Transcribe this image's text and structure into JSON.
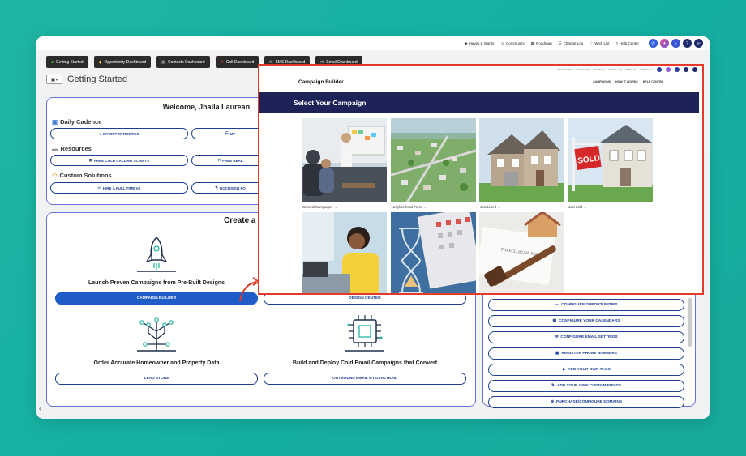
{
  "topbar": {
    "links": [
      "Haves & Wants",
      "Community",
      "Roadmap",
      "Change Log",
      "Wish List",
      "Help Center"
    ],
    "icons": [
      {
        "name": "phone-icon",
        "color": "#2f5fe0",
        "glyph": "✆"
      },
      {
        "name": "gradient-icon",
        "color": "#9b51e0",
        "glyph": "✦"
      },
      {
        "name": "bell-icon",
        "color": "#3955d4",
        "glyph": "♪"
      },
      {
        "name": "help-icon",
        "color": "#1e2a6b",
        "glyph": "?"
      },
      {
        "name": "avatar",
        "color": "#1e2a6b",
        "glyph": "JP"
      }
    ]
  },
  "tabs": [
    "Getting Started",
    "Opportunity Dashboard",
    "Contacts Dashboard",
    "Call Dashboard",
    "SMS Dashboard",
    "Email Dashboard"
  ],
  "page_title": "Getting Started",
  "welcome": {
    "heading": "Welcome, Jhaila Laurean",
    "daily_cadence": "Daily Cadence",
    "resources": "Resources",
    "custom_solutions": "Custom Solutions",
    "btn_opportunities": "MY OPPORTUNITIES",
    "btn_my": "MY",
    "btn_cold_scripts": "FREE COLD CALLING SCRIPTS",
    "btn_free_real": "FREE REAL",
    "btn_hire_va": "HIRE A FULL TIME VA",
    "btn_docusign": "DOCUSIGN FO"
  },
  "create": {
    "heading": "Create a",
    "feature1_title": "Launch Proven Campaigns from Pre-Built Designs",
    "feature1_btn": "CAMPAIGN BUILDER",
    "feature2_btn": "DESIGN CENTER",
    "feature3_title": "Order Accurate Homeowner and Property Data",
    "feature3_btn": "LEAD STORE",
    "feature4_title": "Build and Deploy Cold Email Campaigns that Convert",
    "feature4_btn": "OUTBOUND EMAIL BY DEALTRAIL"
  },
  "settings": {
    "buttons": [
      "CONFIGURE OPPORTUNITIES",
      "CONFIGURE YOUR CALENDARS",
      "CONFIGURE EMAIL SETTINGS",
      "REGISTER PHONE NUMBERS",
      "ADD YOUR OWN TAGS",
      "ADD YOUR OWN CUSTOM FIELDS",
      "PURCHASE/CONFIGURE DOMAINS"
    ]
  },
  "overlay": {
    "topbar_links": [
      "Haves & Wants",
      "Community",
      "Roadmap",
      "Change Log",
      "Wish List",
      "Help Center"
    ],
    "brand": "Campaign Builder",
    "nav_links": [
      "CAMPAIGNS",
      "HOW IT WORKS",
      "HELP CENTER"
    ],
    "banner": "Select Your Campaign",
    "captions": [
      "General Campaigns →",
      "Neighborhood Farm →",
      "Just Listed →",
      "Just Sold →"
    ],
    "sold_sign": "SOLD",
    "foreclosure_notice": "FORECLOSURE NOTICE"
  }
}
